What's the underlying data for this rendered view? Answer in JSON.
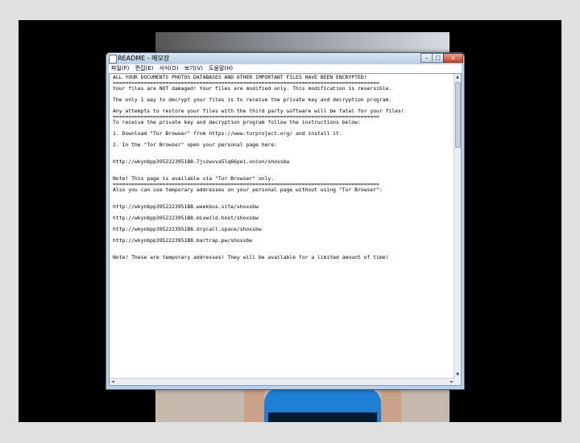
{
  "window": {
    "title": "README - 메모장",
    "controls": {
      "minimize": "–",
      "maximize": "□",
      "close": "x"
    }
  },
  "menu": [
    "파일(F)",
    "편집(E)",
    "서식(O)",
    "보기(V)",
    "도움말(H)"
  ],
  "document": {
    "lines": [
      "ALL YOUR DOCUMENTS PHOTOS DATABASES AND OTHER IMPORTANT FILES HAVE BEEN ENCRYPTED!",
      "======================================================================================",
      "Your files are NOT damaged! Your files are modified only. This modification is reversible.",
      "",
      "The only 1 way to decrypt your files is to receive the private key and decryption program.",
      "",
      "Any attempts to restore your files with the third party software will be fatal for your files!",
      "======================================================================================",
      "To receive the private key and decryption program follow the instructions below:",
      "",
      "1. Download \"Tor Browser\" from https://www.torproject.org/ and install it.",
      "",
      "2. In the \"Tor Browser\" open your personal page here:",
      "",
      "",
      "http://wkynbpp3952223951B8.7jvzwvva5lq66pei.onion/shoxsbw",
      "",
      "",
      "Note! This page is available via \"Tor Browser\" only.",
      "======================================================================================",
      "Also you can use temporary addresses on your personal page without using \"Tor Browser\":",
      "",
      "",
      "http://wkynbpp3952223951B8.weekbus.site/shoxsbw",
      "",
      "http://wkynbpp3952223951B8.mixwild.host/shoxsbw",
      "",
      "http://wkynbpp3952223951B8.drycall.space/shoxsbw",
      "",
      "http://wkynbpp3952223951B8.bartrap.pw/shoxsbw",
      "",
      "",
      "Note! These are temporary addresses! They will be available for a limited amount of time!"
    ]
  },
  "scrollbar": {
    "up": "▲",
    "down": "▼",
    "left": "◄",
    "right": "►"
  }
}
